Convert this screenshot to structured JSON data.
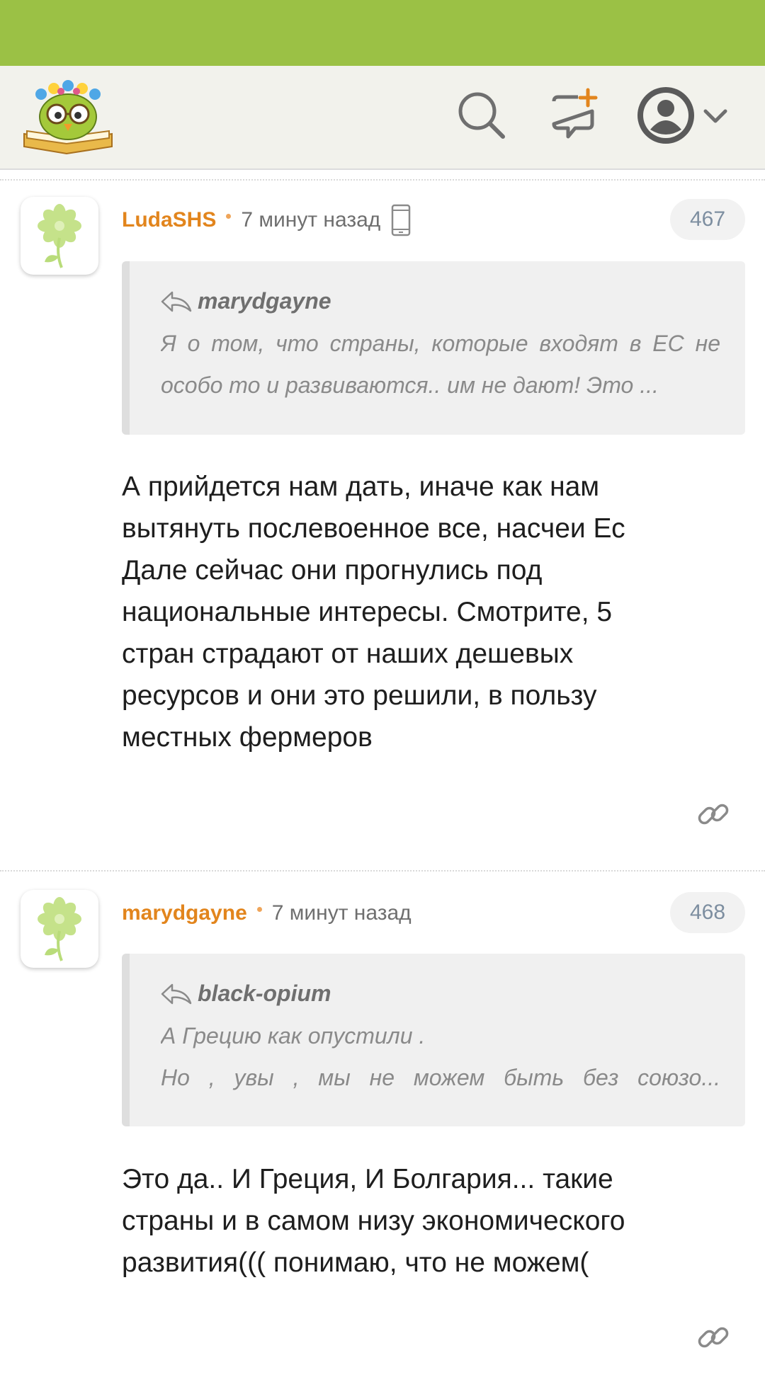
{
  "header": {
    "logo_icon": "smiley-owl-book-logo",
    "search_icon": "search-icon",
    "new_post_icon": "chat-plus-icon",
    "account_icon": "user-circle-icon",
    "colors": {
      "status_bar": "#9bc145",
      "header_bg": "#f2f2ec",
      "author": "#e2851d"
    }
  },
  "comments": [
    {
      "author": "LudaSHS",
      "time": "7 минут назад",
      "device_icon": "mobile-phone-icon",
      "number": "467",
      "quote": {
        "author": "marydgayne",
        "lines": [
          "Я о том, что страны, которые входят в ЕС не",
          "особо то и развиваются.. им не дают! Это ..."
        ]
      },
      "body_lines": [
        "А прийдется нам дать, иначе как нам",
        "вытянуть послевоенное все, насчеи Ес",
        "Дале сейчас они прогнулись под",
        "национальные интересы. Смотрите, 5",
        "стран страдают от наших дешевых",
        "ресурсов и они это решили, в пользу",
        "местных фермеров"
      ]
    },
    {
      "author": "marydgayne",
      "time": "7 минут назад",
      "number": "468",
      "quote": {
        "author": "black-opium",
        "lines": [
          "А Грецию как опустили .",
          "Но , увы , мы не можем быть без союзо..."
        ]
      },
      "body_lines": [
        "Это да.. И Греция, И Болгария... такие",
        "страны и в самом низу экономического",
        "развития((( понимаю, что не можем("
      ]
    }
  ]
}
